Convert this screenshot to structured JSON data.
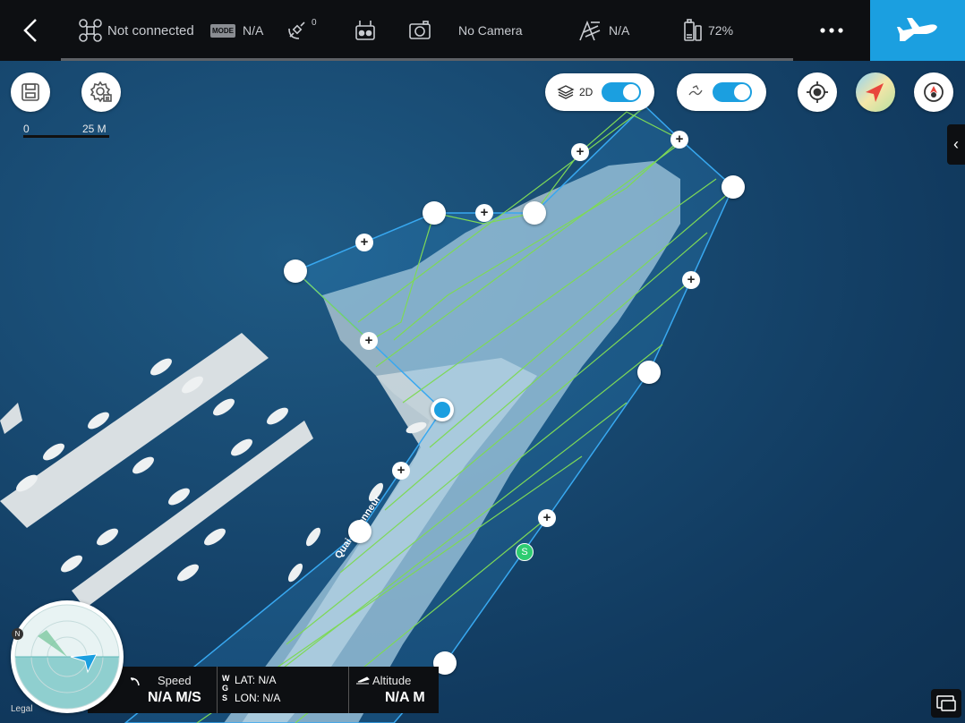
{
  "top_bar": {
    "connection_status": "Not connected",
    "mode_badge": "MODE",
    "mode_value": "N/A",
    "satellite_count": "0",
    "camera_status": "No Camera",
    "altitude_limit_value": "N/A",
    "battery_percent": "72%"
  },
  "map_controls": {
    "view_mode_label": "2D"
  },
  "scale_bar": {
    "start_label": "0",
    "end_label": "25 M"
  },
  "map": {
    "road_label": "Quai d'Honneur",
    "start_marker_label": "S"
  },
  "compass": {
    "north_label": "N"
  },
  "legal_label": "Legal",
  "info_panel": {
    "speed_label": "Speed",
    "speed_value": "N/A M/S",
    "coord_system_letters": [
      "W",
      "G",
      "S"
    ],
    "lat_text": "LAT: N/A",
    "lon_text": "LON: N/A",
    "altitude_label": "Altitude",
    "altitude_value": "N/A M"
  },
  "colors": {
    "accent_blue": "#1b9fe0",
    "flight_line_green": "#7ed957",
    "polygon_edge_blue": "#38a8f0",
    "start_marker_green": "#2ecc71",
    "bar_background": "#0d0f12"
  }
}
